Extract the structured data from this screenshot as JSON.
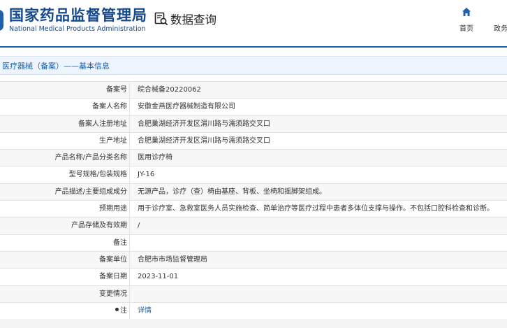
{
  "header": {
    "logo_cn": "国家药品监督管理局",
    "logo_en": "National Medical Products Administration",
    "query_title": "数据查询",
    "nav": [
      {
        "label": "首页",
        "icon": "home-icon"
      },
      {
        "label": "政务"
      }
    ]
  },
  "section": {
    "title": "医疗器械（备案）——基本信息"
  },
  "details": [
    {
      "label": "备案号",
      "value": "皖合械备20220062"
    },
    {
      "label": "备案人名称",
      "value": "安徽金燕医疗器械制造有限公司"
    },
    {
      "label": "备案人注册地址",
      "value": "合肥巢湖经济开发区渭川路与濡须路交叉口"
    },
    {
      "label": "生产地址",
      "value": "合肥巢湖经济开发区渭川路与濡须路交叉口"
    },
    {
      "label": "产品名称/产品分类名称",
      "value": "医用诊疗椅"
    },
    {
      "label": "型号规格/包装规格",
      "value": "JY-16"
    },
    {
      "label": "产品描述/主要组成成分",
      "value": "无源产品，诊疗（查）椅由基座、背板、坐椅和摇脚架组成。"
    },
    {
      "label": "预期用途",
      "value": "用于诊疗室、急救室医务人员实施检查、简单治疗等医疗过程中患者多体位支撑与操作。不包括口腔科检查和诊断。"
    },
    {
      "label": "产品存储及有效期",
      "value": "/"
    },
    {
      "label": "备注",
      "value": ""
    },
    {
      "label": "备案单位",
      "value": "合肥市市场监督管理局"
    },
    {
      "label": "备案日期",
      "value": "2023-11-01"
    },
    {
      "label": "变更情况",
      "value": ""
    },
    {
      "label": "注",
      "value": "详情",
      "icon": "pin-icon"
    }
  ],
  "colors": {
    "brand": "#15498c",
    "accent": "#1e5fa8",
    "row_alt": "#f7f7f7",
    "border": "#e2e2e2"
  }
}
